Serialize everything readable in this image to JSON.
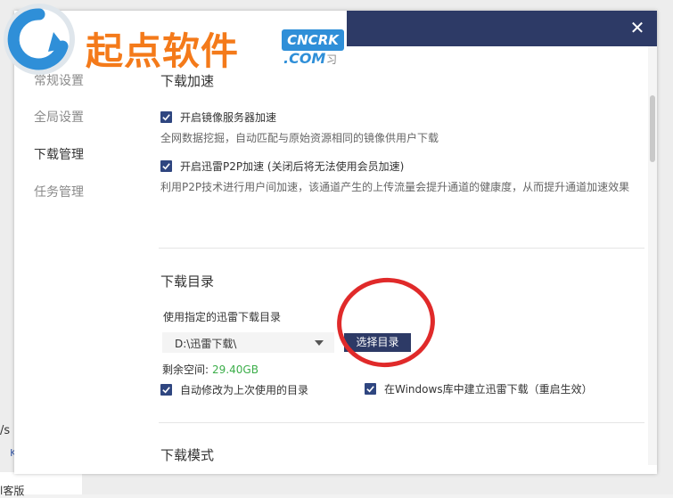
{
  "watermark": {
    "brand_cn": "起点软件",
    "brand_en": "CNCRK",
    "dotcom": ".COM",
    "mark": "习"
  },
  "background": {
    "speed_fragment": "/s",
    "small_fragment": "KE",
    "bottom_fragment": "l客版"
  },
  "dialog": {
    "close_glyph": "✕"
  },
  "sidebar": {
    "items": [
      {
        "label": "常规设置",
        "active": false
      },
      {
        "label": "全局设置",
        "active": false
      },
      {
        "label": "下载管理",
        "active": true
      },
      {
        "label": "任务管理",
        "active": false
      }
    ]
  },
  "content": {
    "accel": {
      "title": "下载加速",
      "mirror": {
        "label": "开启镜像服务器加速",
        "checked": true,
        "desc": "全网数据挖掘，自动匹配与原始资源相同的镜像供用户下载"
      },
      "p2p": {
        "label": "开启迅雷P2P加速 (关闭后将无法使用会员加速)",
        "checked": true,
        "desc": "利用P2P技术进行用户间加速，该通道产生的上传流量会提升通道的健康度，从而提升通道加速效果"
      }
    },
    "dir": {
      "title": "下载目录",
      "use_label": "使用指定的迅雷下载目录",
      "path": "D:\\迅雷下载\\",
      "choose_button": "选择目录",
      "free_label": "剩余空间:",
      "free_value": "29.40GB",
      "auto_modify": {
        "label": "自动修改为上次使用的目录",
        "checked": true
      },
      "windows_lib": {
        "label": "在Windows库中建立迅雷下载（重启生效）",
        "checked": true
      }
    },
    "mode": {
      "title": "下载模式"
    }
  },
  "colors": {
    "header": "#2d3a66",
    "checkbox": "#2f4680",
    "free_space": "#3cae4a",
    "annotation": "#e02a2a",
    "brand_orange": "#f47a1a",
    "brand_blue": "#2f8fd8"
  }
}
